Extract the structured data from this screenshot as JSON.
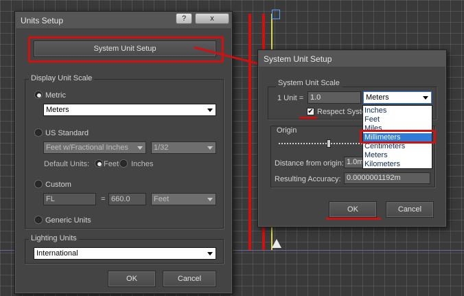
{
  "units_setup": {
    "title": "Units Setup",
    "help_glyph": "?",
    "close_glyph": "x",
    "system_unit_setup_label": "System Unit Setup",
    "display_unit_scale": {
      "group_label": "Display Unit Scale",
      "metric_label": "Metric",
      "metric_value": "Meters",
      "us_standard_label": "US Standard",
      "us_units_value": "Feet w/Fractional Inches",
      "us_fraction_value": "1/32",
      "default_units_label": "Default Units:",
      "feet_label": "Feet",
      "inches_label": "Inches",
      "custom_label": "Custom",
      "custom_name_value": "FL",
      "custom_equals": "=",
      "custom_amount_value": "660.0",
      "custom_unit_value": "Feet",
      "generic_units_label": "Generic Units",
      "selected": "metric"
    },
    "lighting_units": {
      "group_label": "Lighting Units",
      "value": "International"
    },
    "ok_label": "OK",
    "cancel_label": "Cancel"
  },
  "system_unit_setup": {
    "title": "System Unit Setup",
    "scale_group_label": "System Unit Scale",
    "one_unit_label": "1 Unit =",
    "one_unit_value": "1.0",
    "unit_dropdown_value": "Meters",
    "respect_system_label": "Respect Syste",
    "respect_checked": true,
    "dropdown_options": [
      "Inches",
      "Feet",
      "Miles",
      "Millimeters",
      "Centimeters",
      "Meters",
      "Kilometers"
    ],
    "highlighted_option": "Millimeters",
    "origin_group_label": "Origin",
    "distance_label": "Distance from origin:",
    "distance_value": "1.0m",
    "accuracy_label": "Resulting Accuracy:",
    "accuracy_value": "0.0000001192m",
    "ok_label": "OK",
    "cancel_label": "Cancel"
  },
  "colors": {
    "annotation_red": "#d11010",
    "selection_blue": "#2f7bd6",
    "dialog_bg": "#444444"
  }
}
